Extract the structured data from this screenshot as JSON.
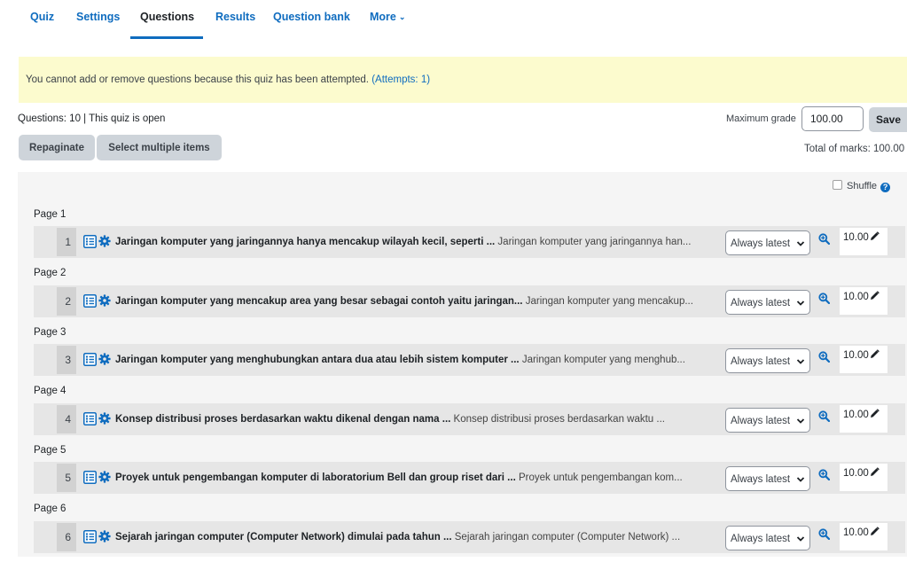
{
  "tabs": [
    {
      "label": "Quiz"
    },
    {
      "label": "Settings"
    },
    {
      "label": "Questions"
    },
    {
      "label": "Results"
    },
    {
      "label": "Question bank"
    },
    {
      "label": "More"
    }
  ],
  "notice": {
    "text": "You cannot add or remove questions because this quiz has been attempted.",
    "link": "(Attempts: 1)"
  },
  "quiz_info": "Questions: 10 | This quiz is open",
  "max_grade": {
    "label": "Maximum grade",
    "value": "100.00",
    "save_label": "Save"
  },
  "buttons": {
    "repaginate": "Repaginate",
    "select_multiple": "Select multiple items"
  },
  "total_marks": "Total of marks: 100.00",
  "shuffle_label": "Shuffle",
  "pages": [
    {
      "label": "Page 1",
      "num": "1",
      "title": "Jaringan komputer yang jaringannya hanya mencakup wilayah kecil, seperti ...",
      "preview": "Jaringan komputer yang jaringannya han...",
      "version": "Always latest",
      "mark": "10.00"
    },
    {
      "label": "Page 2",
      "num": "2",
      "title": "Jaringan komputer yang mencakup area yang besar sebagai contoh yaitu jaringan...",
      "preview": "Jaringan komputer yang mencakup...",
      "version": "Always latest",
      "mark": "10.00"
    },
    {
      "label": "Page 3",
      "num": "3",
      "title": "Jaringan komputer yang menghubungkan antara dua atau lebih sistem komputer ...",
      "preview": "Jaringan komputer yang menghub...",
      "version": "Always latest",
      "mark": "10.00"
    },
    {
      "label": "Page 4",
      "num": "4",
      "title": "Konsep distribusi proses berdasarkan waktu dikenal dengan nama ...",
      "preview": "Konsep distribusi proses berdasarkan waktu ...",
      "version": "Always latest",
      "mark": "10.00"
    },
    {
      "label": "Page 5",
      "num": "5",
      "title": "Proyek untuk pengembangan komputer di laboratorium Bell dan group riset dari ...",
      "preview": "Proyek untuk pengembangan kom...",
      "version": "Always latest",
      "mark": "10.00"
    },
    {
      "label": "Page 6",
      "num": "6",
      "title": "Sejarah jaringan computer (Computer Network) dimulai pada tahun ...",
      "preview": "Sejarah jaringan computer (Computer Network) ...",
      "version": "Always latest",
      "mark": "10.00"
    }
  ],
  "icons": {
    "question_type": "multichoice-list-icon",
    "edit": "gear-icon",
    "preview": "zoom-in-icon",
    "edit_mark": "pencil-icon",
    "dropdown": "chevron-down-icon"
  },
  "colors": {
    "link": "#0f6cbf",
    "notice_bg": "#fcfbce",
    "panel_bg": "#f5f5f5",
    "row_bg": "#e6e6e6"
  }
}
